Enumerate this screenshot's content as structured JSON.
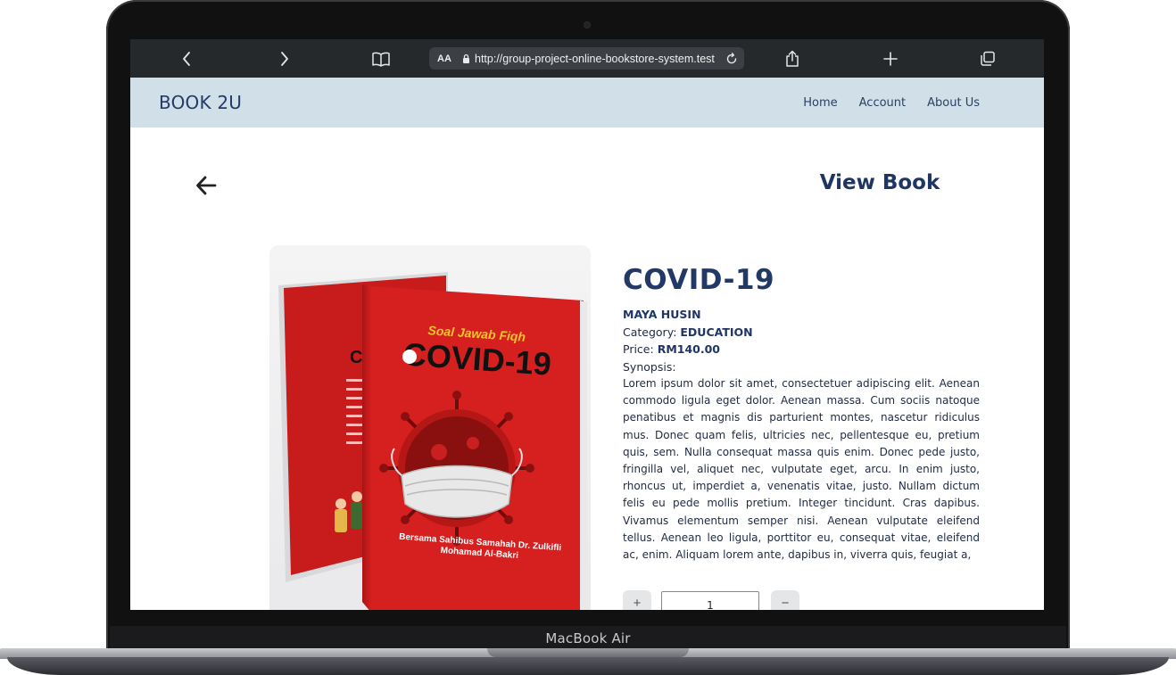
{
  "device": {
    "label": "MacBook Air"
  },
  "browser": {
    "url": "http://group-project-online-bookstore-system.test",
    "text_size_label": "AA"
  },
  "navbar": {
    "brand": "BOOK 2U",
    "links": [
      "Home",
      "Account",
      "About Us"
    ]
  },
  "page": {
    "title": "View Book"
  },
  "book": {
    "cover": {
      "series_text": "Soal Jawab Fiqh",
      "title_text": "COVID-19",
      "author_text": "Bersama Sahibus Samahah Dr. Zulkifli Mohamad Al-Bakri"
    },
    "title": "COVID-19",
    "author": "MAYA HUSIN",
    "category_label": "Category:",
    "category": "EDUCATION",
    "price_label": "Price:",
    "price": "RM140.00",
    "synopsis_label": "Synopsis:",
    "synopsis": "Lorem ipsum dolor sit amet, consectetuer adipiscing elit. Aenean commodo ligula eget dolor. Aenean massa. Cum sociis natoque penatibus et magnis dis parturient montes, nascetur ridiculus mus. Donec quam felis, ultricies nec, pellentesque eu, pretium quis, sem. Nulla consequat massa quis enim. Donec pede justo, fringilla vel, aliquet nec, vulputate eget, arcu. In enim justo, rhoncus ut, imperdiet a, venenatis vitae, justo. Nullam dictum felis eu pede mollis pretium. Integer tincidunt. Cras dapibus. Vivamus elementum semper nisi. Aenean vulputate eleifend tellus. Aenean leo ligula, porttitor eu, consequat vitae, eleifend ac, enim. Aliquam lorem ante, dapibus in, viverra quis, feugiat a,"
  },
  "quantity": {
    "value": "1",
    "increment_label": "+",
    "decrement_label": "−"
  },
  "colors": {
    "navbar_bg": "#d1e0e8",
    "title_color": "#223867",
    "cover_red": "#d61f1f",
    "toolbar_bg": "#26292c"
  }
}
